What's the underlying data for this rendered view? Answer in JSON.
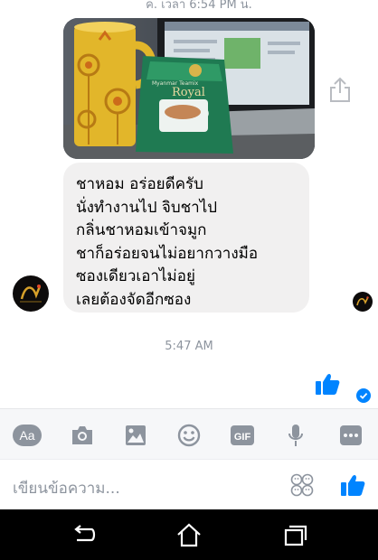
{
  "status_time_partial": "ค. เวลา 6:54 PM น.",
  "photo": {
    "package_label": "Royal",
    "package_sublabel": "Myanmar Teamix"
  },
  "message": {
    "lines": [
      "ชาหอม อร่อยดีครับ",
      "นั่งทำงานไป จิบชาไป",
      "กลิ่นชาหอมเข้าจมูก",
      "ชาก็อร่อยจนไม่อยากวางมือ",
      "ซองเดียวเอาไม่อยู่",
      "เลยต้องจัดอีกซอง"
    ]
  },
  "timestamp": "5:47 AM",
  "toolbar": {
    "text_label": "Aa",
    "gif_label": "GIF",
    "icons": [
      "text-icon",
      "camera-icon",
      "image-icon",
      "emoji-icon",
      "gif-icon",
      "microphone-icon",
      "more-icon"
    ]
  },
  "composer": {
    "placeholder": "เขียนข้อความ...",
    "icons": [
      "sticker-icon",
      "like-icon"
    ]
  },
  "navbar": {
    "icons": [
      "back-icon",
      "home-icon",
      "recent-apps-icon"
    ]
  },
  "colors": {
    "messenger_blue": "#0084ff",
    "bubble_gray": "#f1f0f0",
    "icon_gray": "#8d949e"
  }
}
